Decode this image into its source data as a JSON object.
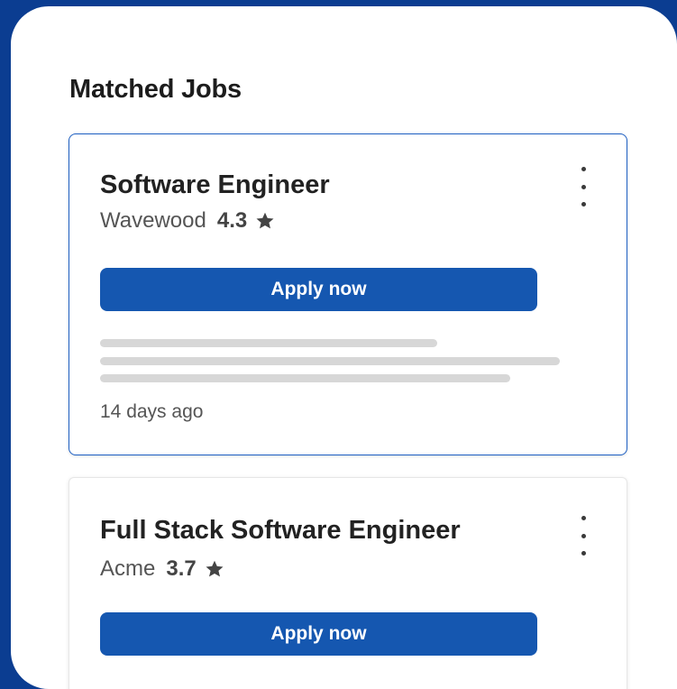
{
  "section": {
    "title": "Matched Jobs"
  },
  "jobs": [
    {
      "title": "Software Engineer",
      "company": "Wavewood",
      "rating": "4.3",
      "apply_label": "Apply now",
      "posted": "14 days ago",
      "selected": true
    },
    {
      "title": "Full Stack Software Engineer",
      "company": "Acme",
      "rating": "3.7",
      "apply_label": "Apply now",
      "selected": false
    }
  ],
  "icons": {
    "rating": "star-icon",
    "menu": "more-vertical-icon"
  },
  "colors": {
    "background": "#0b3d91",
    "accent": "#1557b0",
    "selected_border": "#1d5fc3"
  }
}
